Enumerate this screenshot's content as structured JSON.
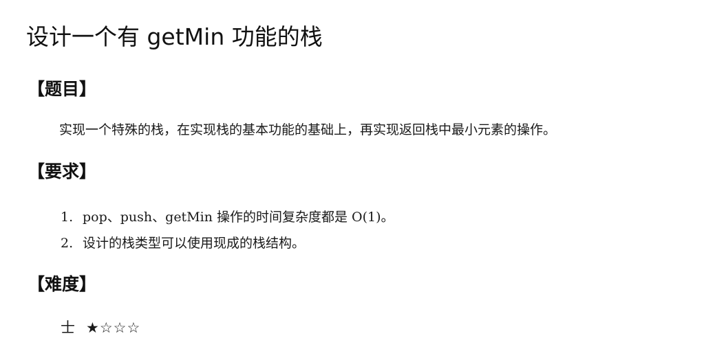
{
  "title": "设计一个有 getMin 功能的栈",
  "sections": {
    "problem": {
      "heading": "【题目】",
      "text": "实现一个特殊的栈，在实现栈的基本功能的基础上，再实现返回栈中最小元素的操作。"
    },
    "requirements": {
      "heading": "【要求】",
      "items": [
        {
          "number": "1.",
          "text": "pop、push、getMin 操作的时间复杂度都是 O(1)。"
        },
        {
          "number": "2.",
          "text": "设计的栈类型可以使用现成的栈结构。"
        }
      ]
    },
    "difficulty": {
      "heading": "【难度】",
      "level": "士",
      "stars": "★☆☆☆",
      "rating": 1,
      "max_rating": 4
    }
  }
}
